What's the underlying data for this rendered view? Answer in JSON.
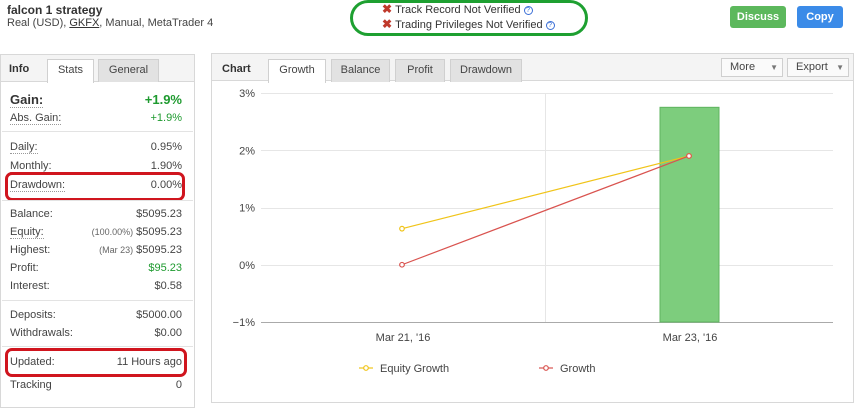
{
  "header": {
    "title": "falcon 1 strategy",
    "sub_prefix": "Real (USD), ",
    "broker": "GKFX",
    "sub_suffix": ", Manual, MetaTrader 4",
    "verification": [
      {
        "text": "Track Record Not Verified",
        "help": "?"
      },
      {
        "text": "Trading Privileges Not Verified",
        "help": "?"
      }
    ],
    "discuss_label": "Discuss",
    "copy_label": "Copy"
  },
  "left_panel": {
    "tabs": {
      "info": "Info",
      "stats": "Stats",
      "general": "General"
    },
    "gain": {
      "label": "Gain:",
      "value": "+1.9%"
    },
    "abs_gain": {
      "label": "Abs. Gain:",
      "value": "+1.9%"
    },
    "daily": {
      "label": "Daily:",
      "value": "0.95%"
    },
    "monthly": {
      "label": "Monthly:",
      "value": "1.90%"
    },
    "drawdown": {
      "label": "Drawdown:",
      "value": "0.00%"
    },
    "balance": {
      "label": "Balance:",
      "value": "$5095.23"
    },
    "equity": {
      "label": "Equity:",
      "prefix": "(100.00%)",
      "value": "$5095.23"
    },
    "highest": {
      "label": "Highest:",
      "prefix": "(Mar 23)",
      "value": "$5095.23"
    },
    "profit": {
      "label": "Profit:",
      "value": "$95.23"
    },
    "interest": {
      "label": "Interest:",
      "value": "$0.58"
    },
    "deposits": {
      "label": "Deposits:",
      "value": "$5000.00"
    },
    "withdrawals": {
      "label": "Withdrawals:",
      "value": "$0.00"
    },
    "updated": {
      "label": "Updated:",
      "value": "11 Hours ago"
    },
    "tracking": {
      "label": "Tracking",
      "value": "0"
    }
  },
  "right_panel": {
    "label": "Chart",
    "tabs": [
      "Growth",
      "Balance",
      "Profit",
      "Drawdown"
    ],
    "more_label": "More",
    "export_label": "Export"
  },
  "colors": {
    "equity_growth": "#f0c419",
    "growth": "#d9534f",
    "bar": "#7dcd7d",
    "positive": "#1e9a2f",
    "highlight_green": "#1ea031",
    "highlight_red": "#d0151e"
  },
  "chart_data": {
    "type": "line",
    "categories": [
      "Mar 21, '16",
      "Mar 23, '16"
    ],
    "y_ticks": [
      "3%",
      "2%",
      "1%",
      "0%",
      "−1%"
    ],
    "ylim": [
      -1,
      3
    ],
    "series": [
      {
        "name": "Equity Growth",
        "values": [
          0.63,
          1.9
        ]
      },
      {
        "name": "Growth",
        "values": [
          0.0,
          1.9
        ]
      }
    ],
    "bars": [
      {
        "category": "Mar 23, '16",
        "value": 2.75
      }
    ],
    "grid": true,
    "legend_position": "bottom"
  }
}
